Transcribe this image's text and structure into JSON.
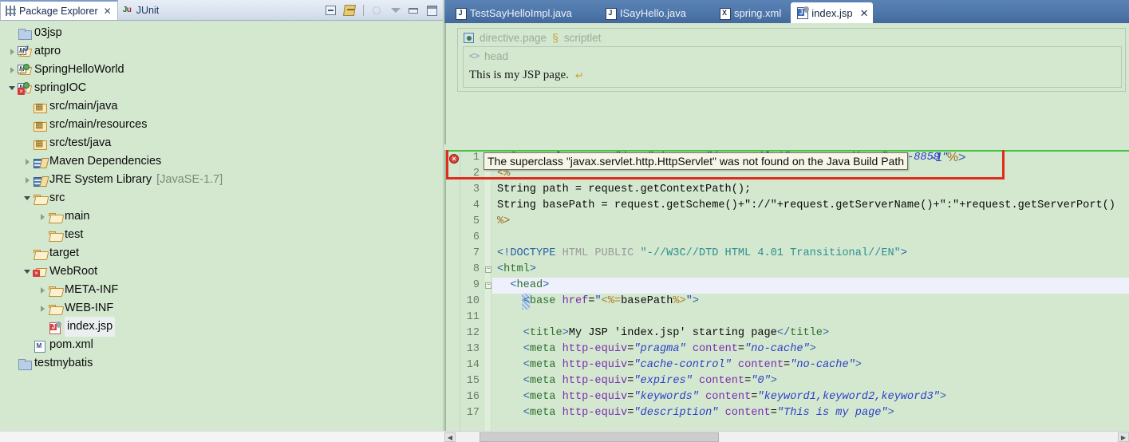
{
  "view_tabs": [
    {
      "label": "Package Explorer",
      "icon": "package-explorer-icon",
      "active": true,
      "closable": true
    },
    {
      "label": "JUnit",
      "icon": "junit-icon",
      "active": false,
      "closable": false
    }
  ],
  "view_toolbar": [
    {
      "name": "collapse-all-button",
      "tip": "Collapse All"
    },
    {
      "name": "link-with-editor-button",
      "tip": "Link with Editor"
    },
    {
      "name": "focus-button",
      "tip": "Focus"
    },
    {
      "name": "view-menu-button",
      "tip": "View Menu"
    },
    {
      "name": "minimize-button",
      "tip": "Minimize"
    },
    {
      "name": "maximize-button",
      "tip": "Maximize"
    }
  ],
  "tree": [
    {
      "label": "03jsp",
      "indent": 0,
      "arrow": "none",
      "icon": "closed-project-folder-icon",
      "selected": false
    },
    {
      "label": "atpro",
      "indent": 0,
      "arrow": "closed",
      "icon": "maven-java-project-warning-icon",
      "selected": false
    },
    {
      "label": "SpringHelloWorld",
      "indent": 0,
      "arrow": "closed",
      "icon": "maven-project-warning-icon",
      "selected": false
    },
    {
      "label": "springIOC",
      "indent": 0,
      "arrow": "open",
      "icon": "maven-project-error-icon",
      "selected": false
    },
    {
      "label": "src/main/java",
      "indent": 1,
      "arrow": "none",
      "icon": "source-folder-icon",
      "selected": false
    },
    {
      "label": "src/main/resources",
      "indent": 1,
      "arrow": "none",
      "icon": "source-folder-icon",
      "selected": false
    },
    {
      "label": "src/test/java",
      "indent": 1,
      "arrow": "none",
      "icon": "source-folder-icon",
      "selected": false
    },
    {
      "label": "Maven Dependencies",
      "indent": 1,
      "arrow": "closed",
      "icon": "library-icon",
      "selected": false
    },
    {
      "label": "JRE System Library",
      "suffix": "[JavaSE-1.7]",
      "indent": 1,
      "arrow": "closed",
      "icon": "library-icon",
      "selected": false
    },
    {
      "label": "src",
      "indent": 1,
      "arrow": "open",
      "icon": "folder-icon",
      "selected": false
    },
    {
      "label": "main",
      "indent": 2,
      "arrow": "closed",
      "icon": "folder-icon",
      "selected": false
    },
    {
      "label": "test",
      "indent": 2,
      "arrow": "none",
      "icon": "folder-icon",
      "selected": false
    },
    {
      "label": "target",
      "indent": 1,
      "arrow": "none",
      "icon": "folder-icon",
      "selected": false
    },
    {
      "label": "WebRoot",
      "indent": 1,
      "arrow": "open",
      "icon": "webroot-folder-error-icon",
      "selected": false
    },
    {
      "label": "META-INF",
      "indent": 2,
      "arrow": "closed",
      "icon": "folder-icon",
      "selected": false
    },
    {
      "label": "WEB-INF",
      "indent": 2,
      "arrow": "closed",
      "icon": "folder-icon",
      "selected": false
    },
    {
      "label": "index.jsp",
      "indent": 2,
      "arrow": "none",
      "icon": "jsp-file-icon",
      "selected": true
    },
    {
      "label": "pom.xml",
      "indent": 1,
      "arrow": "none",
      "icon": "xml-file-icon",
      "selected": false
    },
    {
      "label": "testmybatis",
      "indent": 0,
      "arrow": "none",
      "icon": "closed-project-folder-icon",
      "selected": false
    }
  ],
  "editor_tabs": [
    {
      "label": "TestSayHelloImpl.java",
      "icon": "java-file-icon",
      "active": false,
      "closable": false
    },
    {
      "label": "ISayHello.java",
      "icon": "java-file-icon",
      "active": false,
      "closable": false
    },
    {
      "label": "spring.xml",
      "icon": "xml-file-icon",
      "active": false,
      "closable": false
    },
    {
      "label": "index.jsp",
      "icon": "jsp-file-icon",
      "active": true,
      "closable": true
    }
  ],
  "design_preview": {
    "directive_label": "directive.page",
    "scriptlet_label": "scriptlet",
    "head_label": "head",
    "body_text": "This is my JSP page."
  },
  "error_tooltip": {
    "text": "The superclass \"javax.servlet.http.HttpServlet\" was not found on the Java Build Path",
    "marker_symbol": "×",
    "highlight_color": "#e02b1d"
  },
  "source": {
    "line_numbers": [
      "1",
      "2",
      "3",
      "4",
      "5",
      "6",
      "7",
      "8",
      "9",
      "10",
      "11",
      "12",
      "13",
      "14",
      "15",
      "16",
      "17"
    ],
    "lines": [
      {
        "n": "1",
        "text": "<%@ page language=\"java\" import=\"java.util.*\" pageEncoding=\"ISO-8859-1\"%>",
        "fold": false,
        "current": false
      },
      {
        "n": "2",
        "text": "<%",
        "fold": false,
        "current": false
      },
      {
        "n": "3",
        "text": "String path = request.getContextPath();",
        "fold": false,
        "current": false
      },
      {
        "n": "4",
        "text": "String basePath = request.getScheme()+\"://\"+request.getServerName()+\":\"+request.getServerPort()",
        "fold": false,
        "current": false
      },
      {
        "n": "5",
        "text": "%>",
        "fold": false,
        "current": false
      },
      {
        "n": "6",
        "text": "",
        "fold": false,
        "current": false
      },
      {
        "n": "7",
        "text": "<!DOCTYPE HTML PUBLIC \"-//W3C//DTD HTML 4.01 Transitional//EN\">",
        "fold": false,
        "current": false
      },
      {
        "n": "8",
        "text": "<html>",
        "fold": true,
        "current": false
      },
      {
        "n": "9",
        "text": "  <head>",
        "fold": true,
        "current": true
      },
      {
        "n": "10",
        "text": "    <base href=\"<%=basePath%>\">",
        "fold": false,
        "current": false
      },
      {
        "n": "11",
        "text": "",
        "fold": false,
        "current": false
      },
      {
        "n": "12",
        "text": "    <title>My JSP 'index.jsp' starting page</title>",
        "fold": false,
        "current": false
      },
      {
        "n": "13",
        "text": "    <meta http-equiv=\"pragma\" content=\"no-cache\">",
        "fold": false,
        "current": false
      },
      {
        "n": "14",
        "text": "    <meta http-equiv=\"cache-control\" content=\"no-cache\">",
        "fold": false,
        "current": false
      },
      {
        "n": "15",
        "text": "    <meta http-equiv=\"expires\" content=\"0\">",
        "fold": false,
        "current": false
      },
      {
        "n": "16",
        "text": "    <meta http-equiv=\"keywords\" content=\"keyword1,keyword2,keyword3\">",
        "fold": false,
        "current": false
      },
      {
        "n": "17",
        "text": "    <meta http-equiv=\"description\" content=\"This is my page\">",
        "fold": false,
        "current": false
      }
    ],
    "line1_tail": "-1\"%>"
  }
}
